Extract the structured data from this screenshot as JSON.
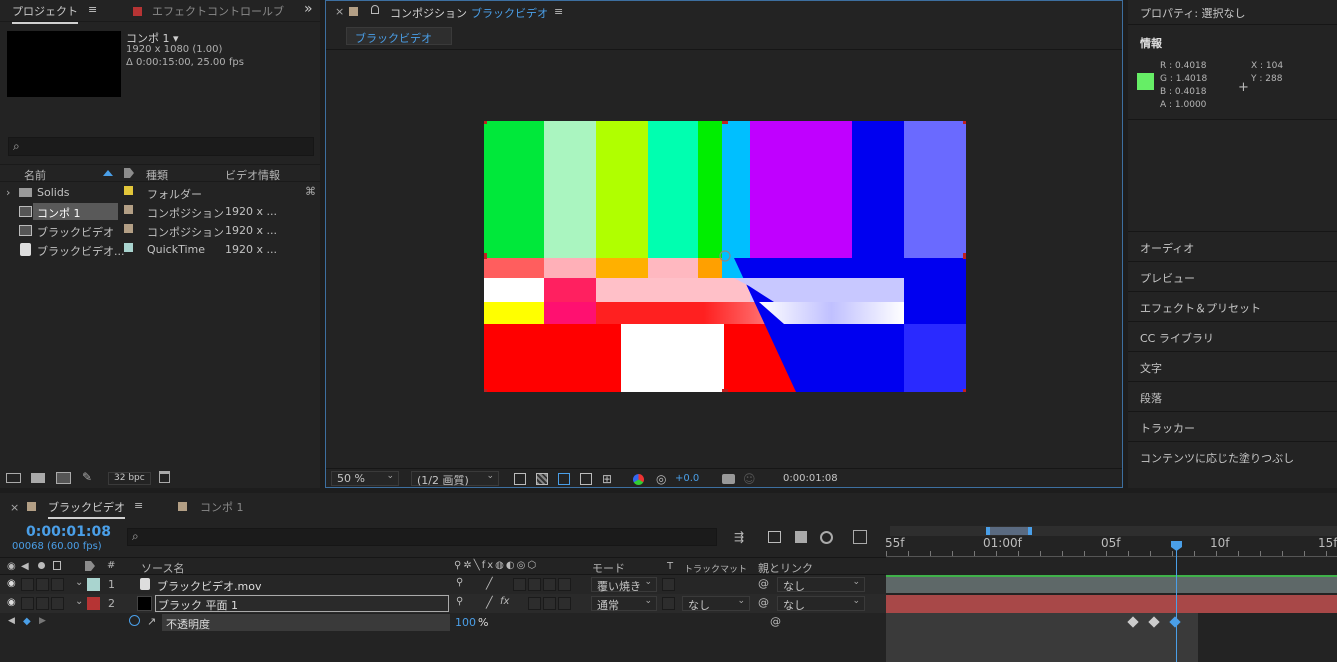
{
  "project": {
    "tab_label": "プロジェクト",
    "menu_icon": "≡",
    "effect_tab_label": "エフェクトコントロール",
    "effect_tab_suffix": "ブ",
    "overflow_icon": "»",
    "selected_name": "コンポ 1",
    "selected_arrow": "▾",
    "selected_dims": "1920 x 1080 (1.00)",
    "selected_duration": "Δ 0:00:15:00, 25.00 fps",
    "search_icon": "⌕",
    "col_name": "名前",
    "col_type": "種類",
    "col_video": "ビデオ情報",
    "items": [
      {
        "name": "Solids",
        "type": "フォルダー",
        "video": "",
        "color": "#e2c63a",
        "icon": "folder-icon"
      },
      {
        "name": "コンポ 1",
        "type": "コンポジション",
        "video": "1920 x ...",
        "color": "#b39f85",
        "icon": "composition-icon"
      },
      {
        "name": "ブラックビデオ",
        "type": "コンポジション",
        "video": "1920 x ...",
        "color": "#b39f85",
        "icon": "composition-icon"
      },
      {
        "name": "ブラックビデオ...",
        "type": "QuickTime",
        "video": "1920 x ...",
        "color": "#a9d4cf",
        "icon": "quicktime-icon"
      }
    ],
    "bpc": "32 bpc"
  },
  "composition": {
    "close": "×",
    "prefix": "コンポジション",
    "name": "ブラックビデオ",
    "menu_icon": "≡",
    "subtab": "ブラックビデオ",
    "zoom": "50 %",
    "resolution": "(1/2 画質)",
    "exposure": "+0.0",
    "timecode": "0:00:01:08"
  },
  "right_panel": {
    "properties": "プロパティ: 選択なし",
    "info_title": "情報",
    "r": "R :  0.4018",
    "g": "G :  1.4018",
    "b": "B :  0.4018",
    "a": "A :  1.0000",
    "x": "X :  104",
    "y": "Y :  288",
    "swatch_color": "#66ee66",
    "items": [
      "オーディオ",
      "プレビュー",
      "エフェクト＆プリセット",
      "CC ライブラリ",
      "文字",
      "段落",
      "トラッカー",
      "コンテンツに応じた塗りつぶし"
    ]
  },
  "timeline": {
    "close": "×",
    "tab_active": "ブラックビデオ",
    "menu_icon": "≡",
    "tab_inactive": "コンポ 1",
    "current_time": "0:00:01:08",
    "frame_info": "00068 (60.00 fps)",
    "search_icon": "⌕",
    "col_hash": "#",
    "col_source": "ソース名",
    "col_mode": "モード",
    "col_t": "T",
    "col_trackmatte": "トラックマット",
    "col_parent": "親とリンク",
    "layers": [
      {
        "num": "1",
        "name": "ブラックビデオ.mov",
        "mode": "覆い焼き",
        "matte": "",
        "parent": "なし",
        "color": "#a9d4cf"
      },
      {
        "num": "2",
        "name": "ブラック 平面 1",
        "mode": "通常",
        "matte": "なし",
        "parent": "なし",
        "color": "#b63434"
      }
    ],
    "property_name": "不透明度",
    "property_value": "100",
    "property_unit": "%",
    "ruler": [
      "55f",
      "01:00f",
      "05f",
      "10f",
      "15f"
    ]
  }
}
